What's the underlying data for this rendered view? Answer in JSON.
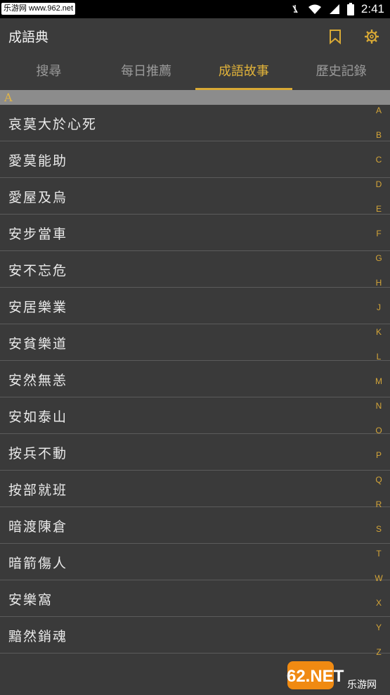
{
  "status_bar": {
    "badge_text": "乐游网 www.962.net",
    "time": "2:41"
  },
  "app_bar": {
    "title": "成語典",
    "bookmark_icon": "bookmark-icon",
    "settings_icon": "gear-icon"
  },
  "tabs": [
    {
      "label": "搜尋"
    },
    {
      "label": "每日推薦"
    },
    {
      "label": "成語故事",
      "active": true
    },
    {
      "label": "歷史記錄"
    }
  ],
  "section": {
    "letter": "A"
  },
  "idioms": [
    "哀莫大於心死",
    "愛莫能助",
    "愛屋及烏",
    "安步當車",
    "安不忘危",
    "安居樂業",
    "安貧樂道",
    "安然無恙",
    "安如泰山",
    "按兵不動",
    "按部就班",
    "暗渡陳倉",
    "暗箭傷人",
    "安樂窩",
    "黯然銷魂"
  ],
  "index_letters": [
    "A",
    "B",
    "C",
    "D",
    "E",
    "F",
    "G",
    "H",
    "J",
    "K",
    "L",
    "M",
    "N",
    "O",
    "P",
    "Q",
    "R",
    "S",
    "T",
    "W",
    "X",
    "Y",
    "Z"
  ],
  "watermark": {
    "brand": "962.NET",
    "sub": "乐游网"
  },
  "colors": {
    "accent": "#d8a935",
    "background": "#3a3a3a",
    "section": "#8c8c8c"
  }
}
